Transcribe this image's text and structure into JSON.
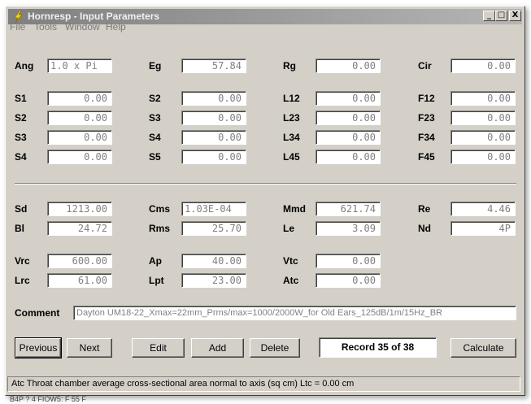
{
  "window": {
    "title": "Hornresp - Input Parameters"
  },
  "menu": [
    "File",
    "Tools",
    "Window",
    "Help"
  ],
  "titlebar_buttons": {
    "minimize": "_",
    "maximize": "□",
    "close": "X"
  },
  "fields": {
    "Ang": "1.0 x Pi",
    "Eg": "57.84",
    "Rg": "0.00",
    "Cir": "0.00",
    "S1": "0.00",
    "S2_mid": "0.00",
    "L12": "0.00",
    "F12": "0.00",
    "S2": "0.00",
    "S3_mid": "0.00",
    "L23": "0.00",
    "F23": "0.00",
    "S3": "0.00",
    "S4_mid": "0.00",
    "L34": "0.00",
    "F34": "0.00",
    "S4": "0.00",
    "S5_mid": "0.00",
    "L45": "0.00",
    "F45": "0.00",
    "Sd": "1213.00",
    "Cms": "1.03E-04",
    "Mmd": "621.74",
    "Re": "4.46",
    "Bl": "24.72",
    "Rms": "25.70",
    "Le": "3.09",
    "Nd": "4P",
    "Vrc": "600.00",
    "Ap": "40.00",
    "Vtc": "0.00",
    "Lrc": "61.00",
    "Lpt": "23.00",
    "Atc": "0.00"
  },
  "labels": {
    "Ang": "Ang",
    "Eg": "Eg",
    "Rg": "Rg",
    "Cir": "Cir",
    "S1": "S1",
    "S2_mid": "S2",
    "L12": "L12",
    "F12": "F12",
    "S2": "S2",
    "S3_mid": "S3",
    "L23": "L23",
    "F23": "F23",
    "S3": "S3",
    "S4_mid": "S4",
    "L34": "L34",
    "F34": "F34",
    "S4": "S4",
    "S5_mid": "S5",
    "L45": "L45",
    "F45": "F45",
    "Sd": "Sd",
    "Cms": "Cms",
    "Mmd": "Mmd",
    "Re": "Re",
    "Bl": "Bl",
    "Rms": "Rms",
    "Le": "Le",
    "Nd": "Nd",
    "Vrc": "Vrc",
    "Ap": "Ap",
    "Vtc": "Vtc",
    "Lrc": "Lrc",
    "Lpt": "Lpt",
    "Atc": "Atc",
    "Comment": "Comment"
  },
  "comment": "Dayton UM18-22_Xmax=22mm_Prms/max=1000/2000W_for Old Ears_125dB/1m/15Hz_BR",
  "buttons": {
    "previous": "Previous",
    "next": "Next",
    "edit": "Edit",
    "add": "Add",
    "delete": "Delete",
    "calculate": "Calculate"
  },
  "record": "Record 35 of 38",
  "status": "Atc   Throat chamber average cross-sectional area normal to axis  (sq cm)   Ltc = 0.00 cm",
  "behind_text": "B4P  ?  4 FIOW5: F 55 F"
}
